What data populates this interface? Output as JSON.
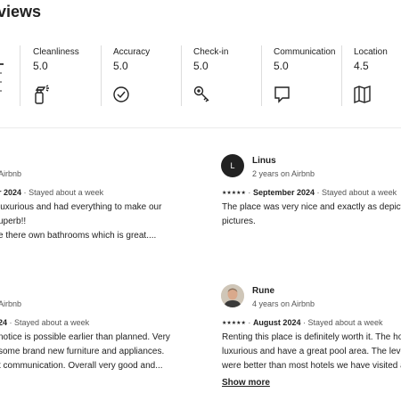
{
  "page_title": "views",
  "ratings": [
    {
      "label": "Cleanliness",
      "value": "5.0",
      "icon": "spray-bottle-icon"
    },
    {
      "label": "Accuracy",
      "value": "5.0",
      "icon": "check-circle-icon"
    },
    {
      "label": "Check-in",
      "value": "5.0",
      "icon": "key-icon"
    },
    {
      "label": "Communication",
      "value": "5.0",
      "icon": "chat-bubble-icon"
    },
    {
      "label": "Location",
      "value": "4.5",
      "icon": "map-icon"
    }
  ],
  "reviews": [
    {
      "name": "",
      "since": "Airbnb",
      "stars": "★★★★★",
      "date": "r 2024",
      "stay": "Stayed about a week",
      "lines": [
        "luxurious and had everything to make our",
        "uperb!!",
        "e there own bathrooms which is great...."
      ]
    },
    {
      "name": "Linus",
      "avatar_letter": "L",
      "since": "2 years on Airbnb",
      "stars": "★★★★★",
      "date": "September 2024",
      "stay": "Stayed about a week",
      "lines": [
        "The place was very nice and exactly as depicted",
        "pictures."
      ]
    },
    {
      "name": "",
      "since": "Airbnb",
      "stars": "",
      "date": "24",
      "stay": "Stayed about a week",
      "lines": [
        "notice is possible earlier than planned. Very",
        "some brand new furniture and appliances.",
        "t communication. Overall very good and..."
      ]
    },
    {
      "name": "Rune",
      "since": "4 years on Airbnb",
      "stars": "★★★★★",
      "date": "August 2024",
      "stay": "Stayed about a week",
      "lines": [
        "Renting this place is definitely worth it. The hous",
        "luxurious and have a great pool area. The level of",
        "were better than most hotels we have visited an"
      ],
      "show_more": "Show more"
    }
  ],
  "separator": "·"
}
